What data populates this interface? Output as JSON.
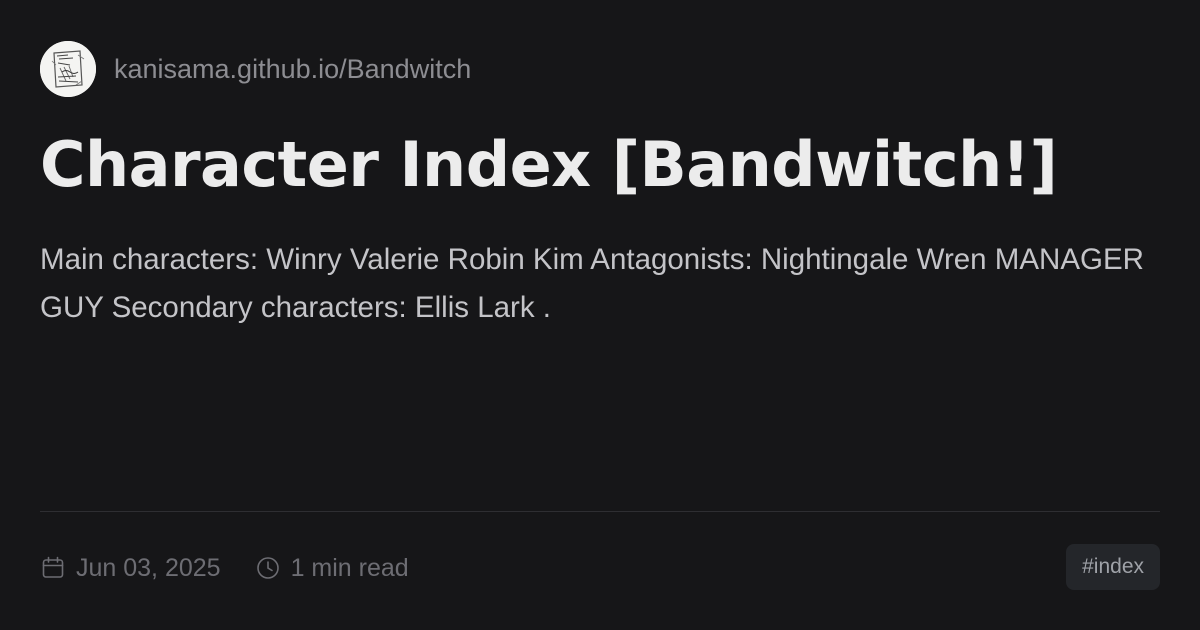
{
  "site": {
    "url": "kanisama.github.io/Bandwitch",
    "avatar_icon": "sketch-logo-icon"
  },
  "post": {
    "title": "Character Index [Bandwitch!]",
    "description": "Main characters: Winry Valerie Robin Kim Antagonists: Nightingale Wren MANAGER GUY Secondary characters: Ellis Lark ."
  },
  "meta": {
    "date": "Jun 03, 2025",
    "date_icon": "calendar-icon",
    "read_time": "1 min read",
    "read_time_icon": "clock-icon"
  },
  "tags": [
    "#index"
  ],
  "colors": {
    "background": "#161618",
    "title": "#ececec",
    "text": "#c4c4c8",
    "muted": "#6d6d73",
    "tag_bg": "#24262a"
  }
}
